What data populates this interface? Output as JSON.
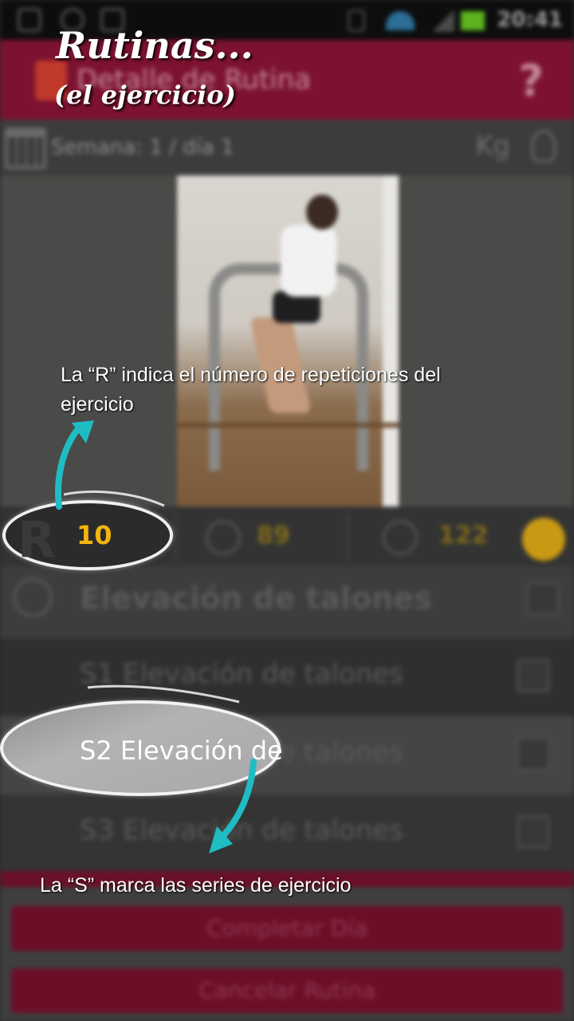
{
  "status_bar": {
    "time": "20:41",
    "icons": [
      "upload-icon",
      "sync-icon",
      "image-icon",
      "vibrate-icon",
      "wifi-icon",
      "signal-icon",
      "battery-icon"
    ],
    "battery_color": "#5db31f"
  },
  "action_bar": {
    "title": "Detalle de Rutina",
    "help_label": "?",
    "color": "#7c1230"
  },
  "sub_bar": {
    "week_day": "Semana: 1 / día 1",
    "unit": "Kg"
  },
  "stats": {
    "repetitions_letter": "R",
    "repetitions": "10",
    "stat_1": "89",
    "stat_2": "122",
    "accent_color": "#f2b40f"
  },
  "exercise": {
    "title": "Elevación de talones",
    "series": [
      {
        "label": "S1 Elevación de talones"
      },
      {
        "label": "S2 Elevación de talones"
      },
      {
        "label": "S3 Elevación de talones"
      }
    ]
  },
  "footer": {
    "complete_day": "Completar Día",
    "cancel_routine": "Cancelar Rutina"
  },
  "annotations": {
    "title": "Rutinas...",
    "subtitle": "(el ejercicio)",
    "note_r": "La “R” indica el número de repeticiones del ejercicio",
    "note_s": "La “S” marca las series de ejercicio",
    "bubble_s_text": "S2 Elevación de",
    "arrow_color": "#1fbcc4"
  }
}
